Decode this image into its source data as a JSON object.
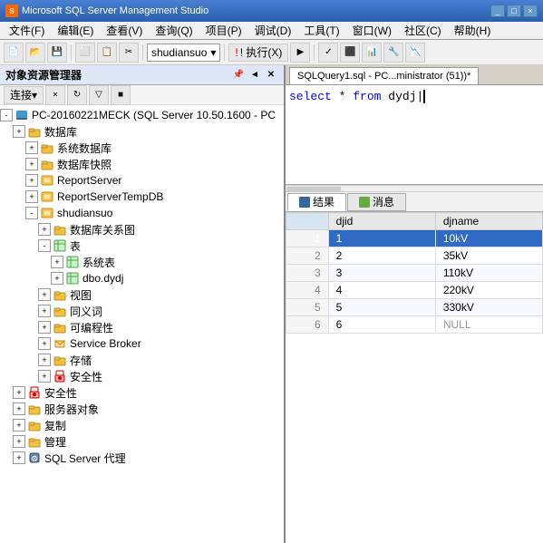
{
  "titlebar": {
    "icon": "SQL",
    "title": "Microsoft SQL Server Management Studio"
  },
  "menubar": {
    "items": [
      "文件(F)",
      "编辑(E)",
      "查看(V)",
      "查询(Q)",
      "项目(P)",
      "调试(D)",
      "工具(T)",
      "窗口(W)",
      "社区(C)",
      "帮助(H)"
    ]
  },
  "toolbar": {
    "new_query_label": "新建查询(N)",
    "database_dropdown": "shudiansuo",
    "execute_label": "! 执行(X)",
    "execute_shortcut": "▶"
  },
  "left_panel": {
    "title": "对象资源管理器",
    "connect_label": "连接▾",
    "tree": [
      {
        "id": "server",
        "indent": 0,
        "expand": "-",
        "icon": "🖥",
        "label": "PC-20160221MECK (SQL Server 10.50.1600 - PC",
        "level": 0
      },
      {
        "id": "databases",
        "indent": 1,
        "expand": "+",
        "icon": "📁",
        "label": "数据库",
        "level": 1
      },
      {
        "id": "sys-dbs",
        "indent": 2,
        "expand": "+",
        "icon": "📁",
        "label": "系统数据库",
        "level": 2
      },
      {
        "id": "snapshots",
        "indent": 2,
        "expand": "+",
        "icon": "📁",
        "label": "数据库快照",
        "level": 2
      },
      {
        "id": "reportserver",
        "indent": 2,
        "expand": "+",
        "icon": "🗄",
        "label": "ReportServer",
        "level": 2
      },
      {
        "id": "reportservertempdb",
        "indent": 2,
        "expand": "+",
        "icon": "🗄",
        "label": "ReportServerTempDB",
        "level": 2
      },
      {
        "id": "shudiansuo",
        "indent": 2,
        "expand": "-",
        "icon": "🗄",
        "label": "shudiansuo",
        "level": 2
      },
      {
        "id": "db-diagrams",
        "indent": 3,
        "expand": "+",
        "icon": "📋",
        "label": "数据库关系图",
        "level": 3
      },
      {
        "id": "tables",
        "indent": 3,
        "expand": "-",
        "icon": "📁",
        "label": "表",
        "level": 3
      },
      {
        "id": "sys-tables",
        "indent": 4,
        "expand": "+",
        "icon": "📁",
        "label": "系统表",
        "level": 4
      },
      {
        "id": "dbo-dydj",
        "indent": 4,
        "expand": "+",
        "icon": "🟩",
        "label": "dbo.dydj",
        "level": 4,
        "selected": false
      },
      {
        "id": "views",
        "indent": 3,
        "expand": "+",
        "icon": "📁",
        "label": "视图",
        "level": 3
      },
      {
        "id": "synonyms",
        "indent": 3,
        "expand": "+",
        "icon": "📁",
        "label": "同义词",
        "level": 3
      },
      {
        "id": "programmability",
        "indent": 3,
        "expand": "+",
        "icon": "📁",
        "label": "可编程性",
        "level": 3
      },
      {
        "id": "service-broker",
        "indent": 3,
        "expand": "+",
        "icon": "📁",
        "label": "Service Broker",
        "level": 3
      },
      {
        "id": "storage",
        "indent": 3,
        "expand": "+",
        "icon": "📁",
        "label": "存储",
        "level": 3
      },
      {
        "id": "security-db",
        "indent": 3,
        "expand": "+",
        "icon": "📁",
        "label": "安全性",
        "level": 3
      },
      {
        "id": "security",
        "indent": 1,
        "expand": "+",
        "icon": "📁",
        "label": "安全性",
        "level": 1
      },
      {
        "id": "server-objects",
        "indent": 1,
        "expand": "+",
        "icon": "📁",
        "label": "服务器对象",
        "level": 1
      },
      {
        "id": "replication",
        "indent": 1,
        "expand": "+",
        "icon": "📁",
        "label": "复制",
        "level": 1
      },
      {
        "id": "management",
        "indent": 1,
        "expand": "+",
        "icon": "📁",
        "label": "管理",
        "level": 1
      },
      {
        "id": "sql-agent",
        "indent": 1,
        "expand": "+",
        "icon": "⚙",
        "label": "SQL Server 代理",
        "level": 1
      }
    ]
  },
  "query_editor": {
    "tab_label": "SQLQuery1.sql - PC...ministrator (51))*",
    "content": "select * from dydj"
  },
  "results": {
    "tabs": [
      "结果",
      "消息"
    ],
    "active_tab": "结果",
    "columns": [
      "",
      "djid",
      "djname"
    ],
    "rows": [
      {
        "num": "1",
        "djid": "1",
        "djname": "10kV",
        "selected": true
      },
      {
        "num": "2",
        "djid": "2",
        "djname": "35kV",
        "selected": false
      },
      {
        "num": "3",
        "djid": "3",
        "djname": "110kV",
        "selected": false
      },
      {
        "num": "4",
        "djid": "4",
        "djname": "220kV",
        "selected": false
      },
      {
        "num": "5",
        "djid": "5",
        "djname": "330kV",
        "selected": false
      },
      {
        "num": "6",
        "djid": "6",
        "djname": "NULL",
        "selected": false
      }
    ]
  }
}
